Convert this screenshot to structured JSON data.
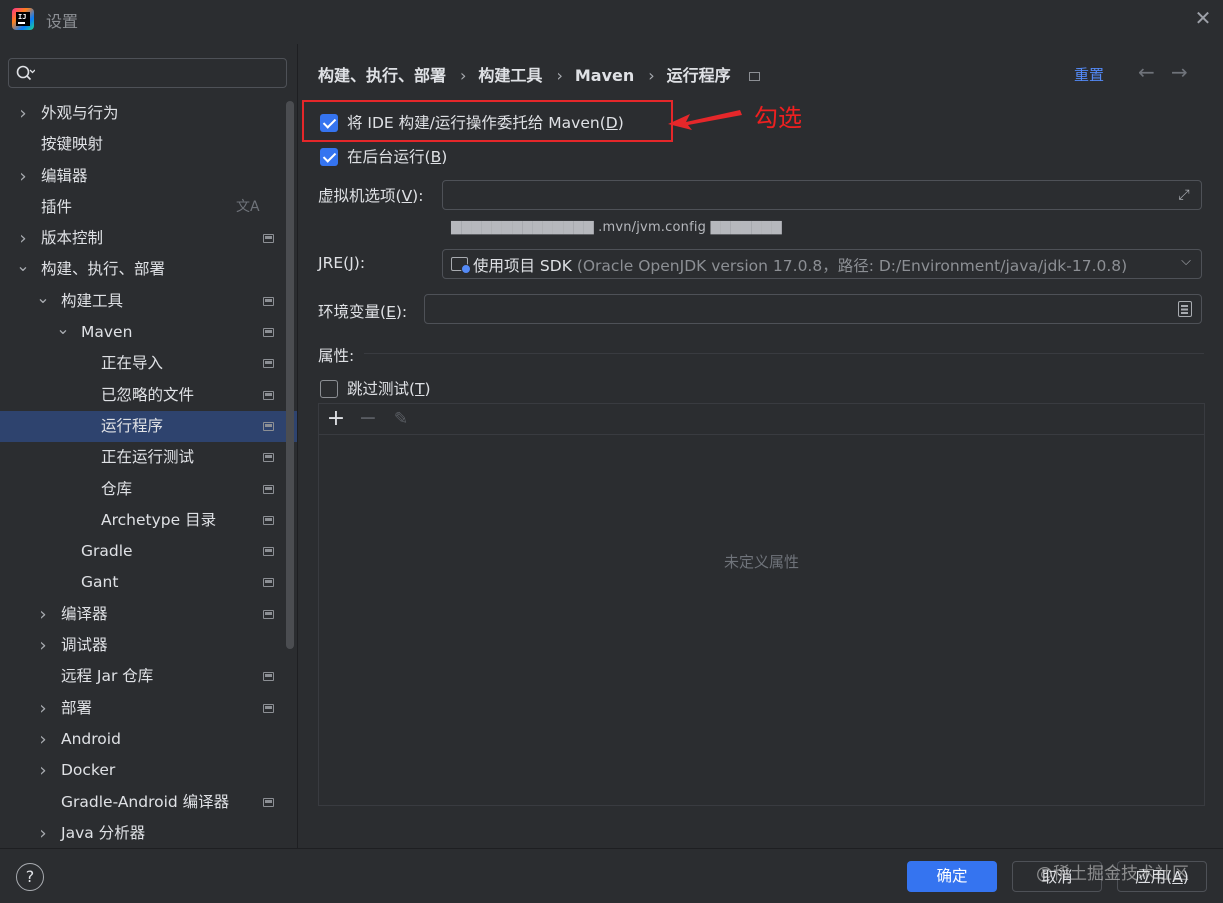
{
  "window": {
    "title": "设置"
  },
  "search": {
    "placeholder": "",
    "value": ""
  },
  "sidebar": {
    "items": [
      {
        "label": "外观与行为",
        "expanded": false,
        "level": 0,
        "has_children": true
      },
      {
        "label": "按键映射",
        "level": 0
      },
      {
        "label": "编辑器",
        "expanded": false,
        "level": 0,
        "has_children": true
      },
      {
        "label": "插件",
        "level": 0,
        "icon": "translate-icon"
      },
      {
        "label": "版本控制",
        "expanded": false,
        "level": 0,
        "has_children": true
      },
      {
        "label": "构建、执行、部署",
        "expanded": true,
        "level": 0,
        "has_children": true
      },
      {
        "label": "构建工具",
        "expanded": true,
        "level": 1,
        "has_children": true
      },
      {
        "label": "Maven",
        "expanded": true,
        "level": 2,
        "has_children": true
      },
      {
        "label": "正在导入",
        "level": 3
      },
      {
        "label": "已忽略的文件",
        "level": 3
      },
      {
        "label": "运行程序",
        "level": 3,
        "selected": true
      },
      {
        "label": "正在运行测试",
        "level": 3
      },
      {
        "label": "仓库",
        "level": 3
      },
      {
        "label": "Archetype 目录",
        "level": 3
      },
      {
        "label": "Gradle",
        "level": 2
      },
      {
        "label": "Gant",
        "level": 2
      },
      {
        "label": "编译器",
        "expanded": false,
        "level": 1,
        "has_children": true
      },
      {
        "label": "调试器",
        "expanded": false,
        "level": 1,
        "has_children": true
      },
      {
        "label": "远程 Jar 仓库",
        "level": 1
      },
      {
        "label": "部署",
        "expanded": false,
        "level": 1,
        "has_children": true
      },
      {
        "label": "Android",
        "expanded": false,
        "level": 1,
        "has_children": true
      },
      {
        "label": "Docker",
        "expanded": false,
        "level": 1,
        "has_children": true
      },
      {
        "label": "Gradle-Android 编译器",
        "level": 1
      },
      {
        "label": "Java 分析器",
        "expanded": false,
        "level": 1,
        "has_children": true
      }
    ]
  },
  "breadcrumb": [
    "构建、执行、部署",
    "构建工具",
    "Maven",
    "运行程序"
  ],
  "header": {
    "reset_label": "重置"
  },
  "annotation": {
    "text": "勾选",
    "color": "#e5272a"
  },
  "options": {
    "delegate": {
      "label_prefix": "将 IDE 构建/运行操作委托给 Maven(",
      "mnemonic": "D",
      "label_suffix": ")",
      "checked": true
    },
    "background": {
      "label_prefix": "在后台运行(",
      "mnemonic": "B",
      "label_suffix": ")",
      "checked": true
    },
    "vm_options": {
      "label_prefix": "虚拟机选项(",
      "mnemonic": "V",
      "label_suffix": "):",
      "value": ""
    },
    "vm_hint": {
      "mask_left": "▇▇▇▇▇▇▇▇▇▇▇▇▇▇",
      "path": ".mvn/jvm.config",
      "mask_right": "▇▇▇▇▇▇▇"
    },
    "jre": {
      "label_prefix": "JRE(",
      "mnemonic": "J",
      "label_suffix": "):",
      "value_main": "使用项目 SDK",
      "value_detail": "(Oracle OpenJDK version 17.0.8，路径: D:/Environment/java/jdk-17.0.8)"
    },
    "env": {
      "label_prefix": "环境变量(",
      "mnemonic": "E",
      "label_suffix": "):",
      "value": ""
    },
    "properties_label": "属性:",
    "skip_tests": {
      "label_prefix": "跳过测试(",
      "mnemonic": "T",
      "label_suffix": ")",
      "checked": false
    },
    "properties_empty": "未定义属性"
  },
  "footer": {
    "ok_label": "确定",
    "cancel_label": "取消",
    "apply_prefix": "应用(",
    "apply_mnemonic": "A",
    "apply_suffix": ")",
    "watermark": "@稀土掘金技术社区"
  },
  "colors": {
    "accent": "#3574f0",
    "link": "#548af7",
    "selected_row": "#2e436e",
    "background": "#2b2d30"
  }
}
